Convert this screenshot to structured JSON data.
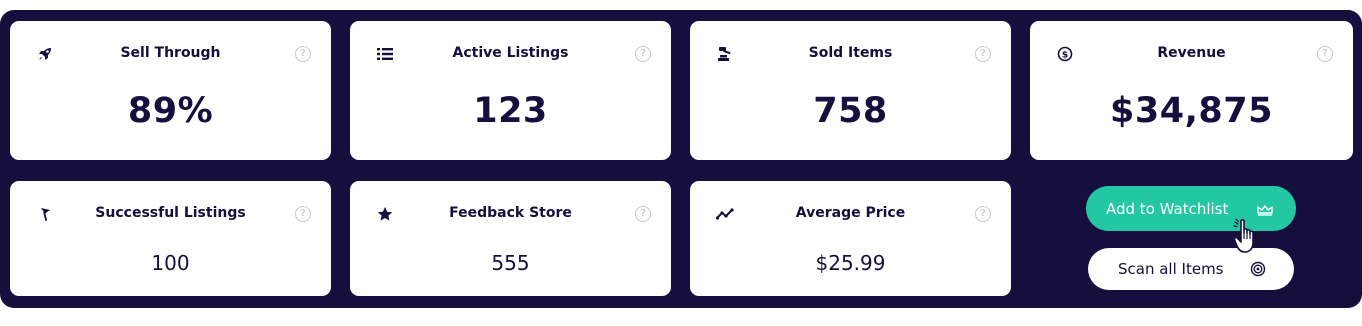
{
  "colors": {
    "panel_bg": "#160f3e",
    "card_bg": "#ffffff",
    "text_dark": "#160f3e",
    "accent_teal": "#23c7a4",
    "help_gray": "#b9b9c4"
  },
  "stats": [
    {
      "title": "Sell Through",
      "value": "89%",
      "icon": "rocket-icon",
      "help": "?"
    },
    {
      "title": "Active Listings",
      "value": "123",
      "icon": "list-icon",
      "help": "?"
    },
    {
      "title": "Sold Items",
      "value": "758",
      "icon": "gavel-icon",
      "help": "?"
    },
    {
      "title": "Revenue",
      "value": "$34,875",
      "icon": "dollar-circle-icon",
      "help": "?"
    },
    {
      "title": "Successful Listings",
      "value": "100",
      "icon": "flag-icon",
      "help": "?"
    },
    {
      "title": "Feedback Store",
      "value": "555",
      "icon": "star-icon",
      "help": "?"
    },
    {
      "title": "Average Price",
      "value": "$25.99",
      "icon": "trend-line-icon",
      "help": "?"
    }
  ],
  "actions": {
    "watchlist_label": "Add to Watchlist",
    "watchlist_icon": "crown-icon",
    "scan_label": "Scan all Items",
    "scan_icon": "target-icon",
    "cursor_icon": "hand-pointer-icon"
  }
}
